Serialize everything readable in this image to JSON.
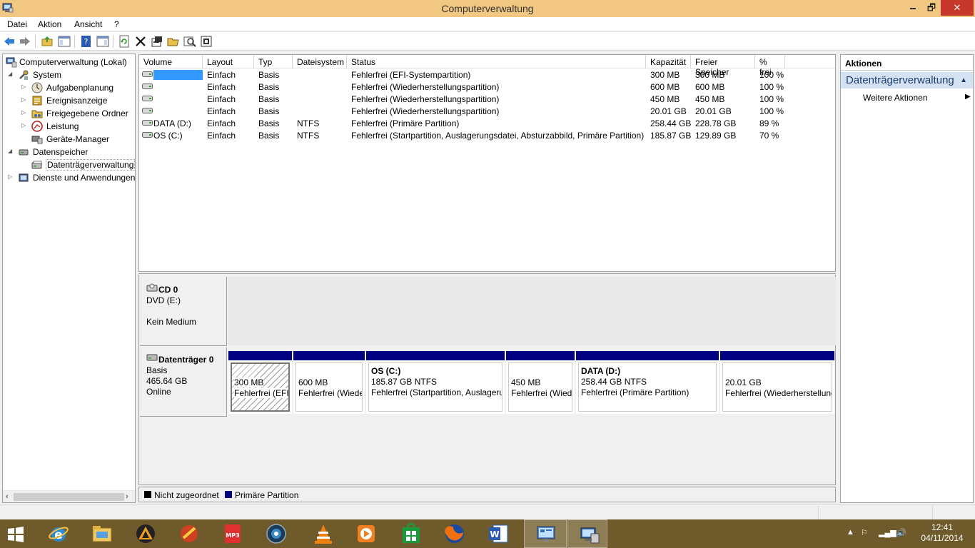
{
  "window": {
    "title": "Computerverwaltung",
    "minimize": "🗕",
    "maximize": "🗗",
    "close": "✕"
  },
  "menu": [
    "Datei",
    "Aktion",
    "Ansicht",
    "?"
  ],
  "tree": [
    {
      "label": "Computerverwaltung (Lokal)",
      "icon": "computer-management-icon"
    },
    {
      "label": "System",
      "icon": "system-tools-icon"
    },
    {
      "label": "Aufgabenplanung",
      "icon": "clock-icon"
    },
    {
      "label": "Ereignisanzeige",
      "icon": "event-viewer-icon"
    },
    {
      "label": "Freigegebene Ordner",
      "icon": "shared-folder-icon"
    },
    {
      "label": "Leistung",
      "icon": "performance-icon"
    },
    {
      "label": "Geräte-Manager",
      "icon": "device-manager-icon"
    },
    {
      "label": "Datenspeicher",
      "icon": "storage-icon"
    },
    {
      "label": "Datenträgerverwaltung",
      "icon": "disk-management-icon"
    },
    {
      "label": "Dienste und Anwendungen",
      "icon": "services-icon"
    }
  ],
  "volumes": {
    "columns": [
      "Volume",
      "Layout",
      "Typ",
      "Dateisystem",
      "Status",
      "Kapazität",
      "Freier Speicher",
      "% frei"
    ],
    "rows": [
      [
        "",
        "Einfach",
        "Basis",
        "",
        "Fehlerfrei (EFI-Systempartition)",
        "300 MB",
        "300 MB",
        "100 %"
      ],
      [
        "",
        "Einfach",
        "Basis",
        "",
        "Fehlerfrei (Wiederherstellungspartition)",
        "600 MB",
        "600 MB",
        "100 %"
      ],
      [
        "",
        "Einfach",
        "Basis",
        "",
        "Fehlerfrei (Wiederherstellungspartition)",
        "450 MB",
        "450 MB",
        "100 %"
      ],
      [
        "",
        "Einfach",
        "Basis",
        "",
        "Fehlerfrei (Wiederherstellungspartition)",
        "20.01 GB",
        "20.01 GB",
        "100 %"
      ],
      [
        "DATA (D:)",
        "Einfach",
        "Basis",
        "NTFS",
        "Fehlerfrei (Primäre Partition)",
        "258.44 GB",
        "228.78 GB",
        "89 %"
      ],
      [
        "OS (C:)",
        "Einfach",
        "Basis",
        "NTFS",
        "Fehlerfrei (Startpartition, Auslagerungsdatei, Absturzabbild, Primäre Partition)",
        "185.87 GB",
        "129.89 GB",
        "70 %"
      ]
    ]
  },
  "cd": {
    "name": "CD 0",
    "type": "DVD (E:)",
    "media": "Kein Medium"
  },
  "disk0": {
    "name": "Datenträger 0",
    "type": "Basis",
    "size": "465.64 GB",
    "state": "Online",
    "partitions": [
      {
        "title": "",
        "size": "300 MB",
        "status": "Fehlerfrei (EFI-Systempartition)"
      },
      {
        "title": "",
        "size": "600 MB",
        "status": "Fehlerfrei (Wiederherstellungspartition)"
      },
      {
        "title": "OS  (C:)",
        "size": "185.87 GB NTFS",
        "status": "Fehlerfrei (Startpartition, Auslagerungsdatei, Absturzabbild, Primäre Partition)"
      },
      {
        "title": "",
        "size": "450 MB",
        "status": "Fehlerfrei (Wiederherstellungspartition)"
      },
      {
        "title": "DATA  (D:)",
        "size": "258.44 GB NTFS",
        "status": "Fehlerfrei (Primäre Partition)"
      },
      {
        "title": "",
        "size": "20.01 GB",
        "status": "Fehlerfrei (Wiederherstellungspartition)"
      }
    ]
  },
  "legend": [
    {
      "label": "Nicht zugeordnet",
      "color": "#000000"
    },
    {
      "label": "Primäre Partition",
      "color": "#000080"
    }
  ],
  "actions": {
    "header": "Aktionen",
    "section": "Datenträgerverwaltung",
    "items": [
      "Weitere Aktionen"
    ]
  },
  "taskbar": {
    "apps": [
      "start-icon",
      "internet-explorer-icon",
      "file-explorer-icon",
      "aimp-icon",
      "media-app-icon",
      "mp3-converter-icon",
      "app-icon",
      "vlc-icon",
      "video-player-icon",
      "store-icon",
      "firefox-icon",
      "word-icon",
      "control-panel-icon",
      "computer-management-icon"
    ],
    "time": "12:41",
    "date": "04/11/2014"
  },
  "colors": {
    "titlebar": "#f2c782",
    "taskbar": "#6e5a2a",
    "primary_partition": "#000080",
    "selection": "#3399ff",
    "close": "#c7382c",
    "actions_section": "#d4e2f3"
  }
}
